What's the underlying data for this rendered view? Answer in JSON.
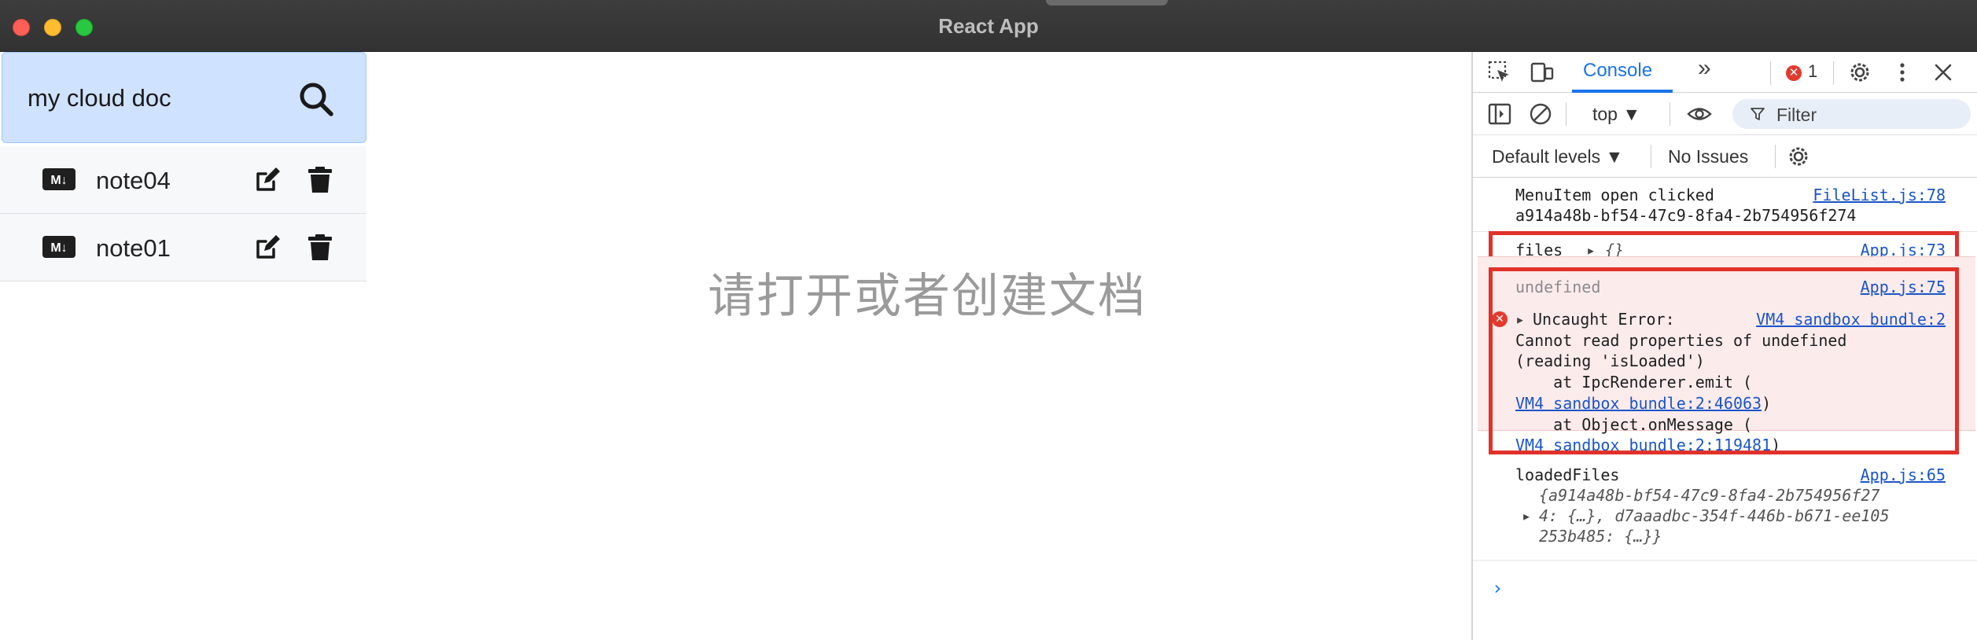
{
  "window": {
    "title": "React App"
  },
  "app": {
    "search_label": "my cloud doc",
    "files": [
      {
        "name": "note04",
        "badge": "M↓"
      },
      {
        "name": "note01",
        "badge": "M↓"
      }
    ],
    "placeholder": "请打开或者创建文档"
  },
  "devtools": {
    "tabs": {
      "console": "Console",
      "more": "»"
    },
    "error_count": "1",
    "context": "top ▼",
    "filter_placeholder": "Filter",
    "levels": "Default levels ▼",
    "issues": "No Issues",
    "logs": [
      {
        "text": "MenuItem open clicked",
        "source": "FileList.js:78",
        "extra": "a914a48b-bf54-47c9-8fa4-2b754956f274"
      },
      {
        "text": "files",
        "value": "{}",
        "source": "App.js:73"
      },
      {
        "text": "undefined",
        "source": "App.js:75"
      }
    ],
    "error": {
      "title": "Uncaught Error:",
      "source": "VM4 sandbox bundle:2",
      "line1": "Cannot read properties of undefined",
      "line2": "(reading 'isLoaded')",
      "line3": "    at IpcRenderer.emit (",
      "link3": "VM4 sandbox bundle:2:46063",
      "line4": "    at Object.onMessage (",
      "link4": "VM4 sandbox bundle:2:119481"
    },
    "loaded": {
      "label": "loadedFiles",
      "source": "App.js:65",
      "line1": "{a914a48b-bf54-47c9-8fa4-2b754956f27",
      "line2": "4: {…}, d7aaadbc-354f-446b-b671-ee105",
      "line3": "253b485: {…}}"
    },
    "prompt": "›"
  }
}
